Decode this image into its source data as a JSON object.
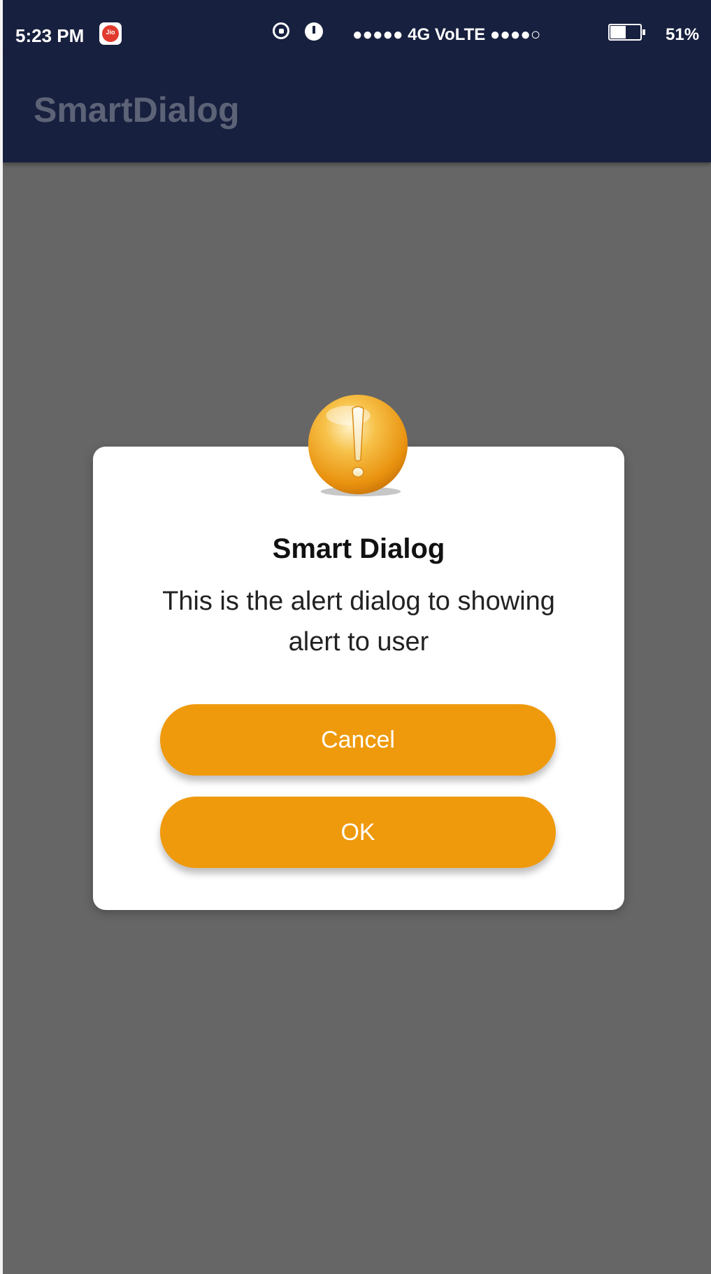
{
  "status_bar": {
    "time": "5:23 PM",
    "carrier_icon_label": "Jio",
    "network": "●●●●● 4G VoLTE ●●●●○",
    "battery_percent_text": "51%",
    "battery_level": 0.51,
    "icons": [
      "rotation-lock-icon",
      "alarm-icon",
      "battery-icon"
    ]
  },
  "app_bar": {
    "title": "SmartDialog"
  },
  "dialog": {
    "icon": "warning-exclamation-icon",
    "title": "Smart Dialog",
    "message": "This is the alert dialog to showing alert to user",
    "cancel_label": "Cancel",
    "ok_label": "OK"
  },
  "colors": {
    "app_bar": "#18203f",
    "scrim": "#666666",
    "dialog_bg": "#ffffff",
    "button": "#ef9a0c",
    "button_text": "#ffffff"
  }
}
